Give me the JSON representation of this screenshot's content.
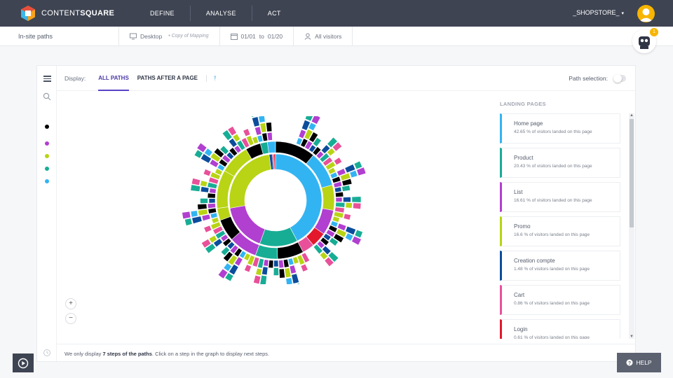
{
  "brand": {
    "name_light": "CONTENT",
    "name_bold": "SQUARE"
  },
  "nav": {
    "define": "DEFINE",
    "analyse": "ANALYSE",
    "act": "ACT"
  },
  "store": "_SHOPSTORE_",
  "subbar": {
    "breadcrumb": "In-site paths",
    "device": "Desktop",
    "mapping": "• Copy of Mapping",
    "date_from": "01/01",
    "date_to_word": "to",
    "date_to": "01/20",
    "segment": "All visitors"
  },
  "bot_badge": "1",
  "toolbar": {
    "display_label": "Display:",
    "tab_all": "ALL PATHS",
    "tab_after": "PATHS AFTER A PAGE",
    "help": "?",
    "path_selection": "Path selection:"
  },
  "colors": {
    "black": "#000000",
    "purple": "#b13fd0",
    "lime": "#b8d414",
    "teal": "#17ad95",
    "blue": "#33b4f2",
    "navy": "#0b4d9c",
    "pink": "#e8509a",
    "red": "#e3182d"
  },
  "legend_dots": [
    "black",
    "purple",
    "lime",
    "teal",
    "blue"
  ],
  "zoom": {
    "in": "+",
    "out": "−"
  },
  "landing": {
    "title": "LANDING PAGES",
    "pages": [
      {
        "name": "Home page",
        "desc": "42.65 % of visitors landed on this page",
        "color": "#33b4f2"
      },
      {
        "name": "Product",
        "desc": "20.43 % of visitors landed on this page",
        "color": "#17ad95"
      },
      {
        "name": "List",
        "desc": "16.61 % of visitors landed on this page",
        "color": "#b13fd0"
      },
      {
        "name": "Promo",
        "desc": "16.6 % of visitors landed on this page",
        "color": "#b8d414"
      },
      {
        "name": "Creation compte",
        "desc": "1.48 % of visitors landed on this page",
        "color": "#0b4d9c"
      },
      {
        "name": "Cart",
        "desc": "0.86 % of visitors landed on this page",
        "color": "#e8509a"
      },
      {
        "name": "Login",
        "desc": "0.61 % of visitors landed on this page",
        "color": "#e3182d"
      }
    ]
  },
  "footer": {
    "pre": "We only display ",
    "bold": "7 steps of the paths",
    "post": ". Click on a step in the graph to display next steps."
  },
  "help_button": "HELP"
}
